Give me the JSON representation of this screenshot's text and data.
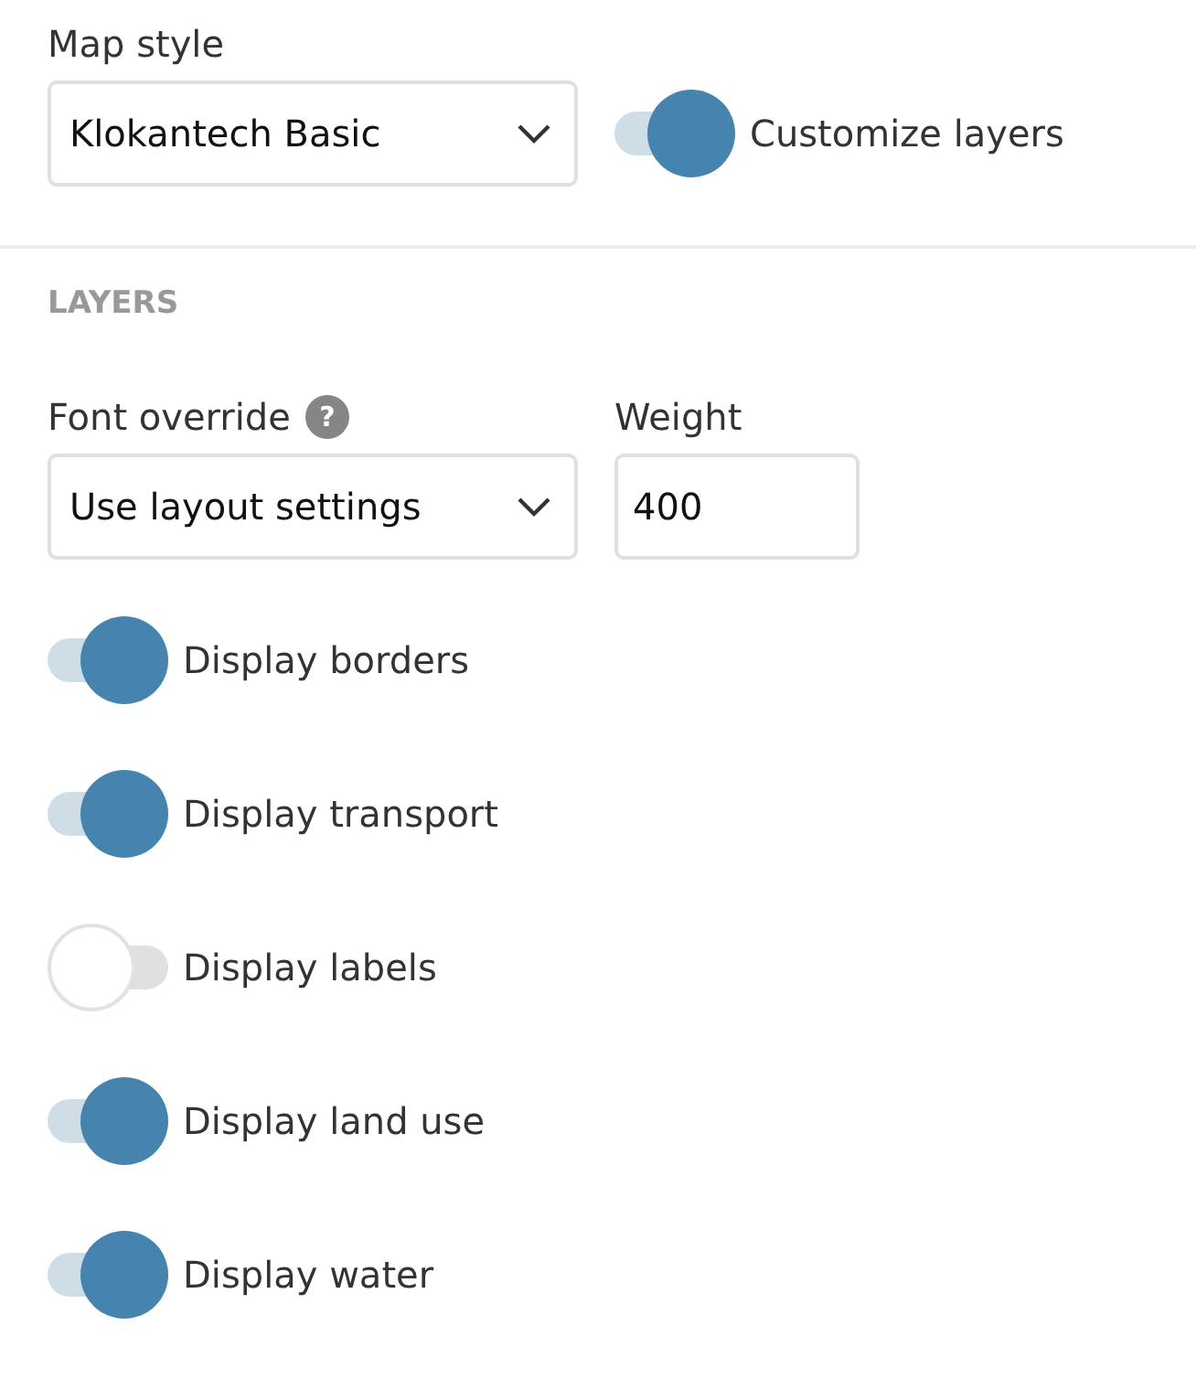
{
  "map_style": {
    "label": "Map style",
    "value": "Klokantech Basic"
  },
  "customize_layers": {
    "label": "Customize layers",
    "on": true
  },
  "layers": {
    "heading": "LAYERS",
    "font_override": {
      "label": "Font override",
      "help_icon": "?",
      "value": "Use layout settings"
    },
    "weight": {
      "label": "Weight",
      "value": "400"
    },
    "toggles": [
      {
        "label": "Display borders",
        "on": true
      },
      {
        "label": "Display transport",
        "on": true
      },
      {
        "label": "Display labels",
        "on": false
      },
      {
        "label": "Display land use",
        "on": true
      },
      {
        "label": "Display water",
        "on": true
      }
    ]
  }
}
